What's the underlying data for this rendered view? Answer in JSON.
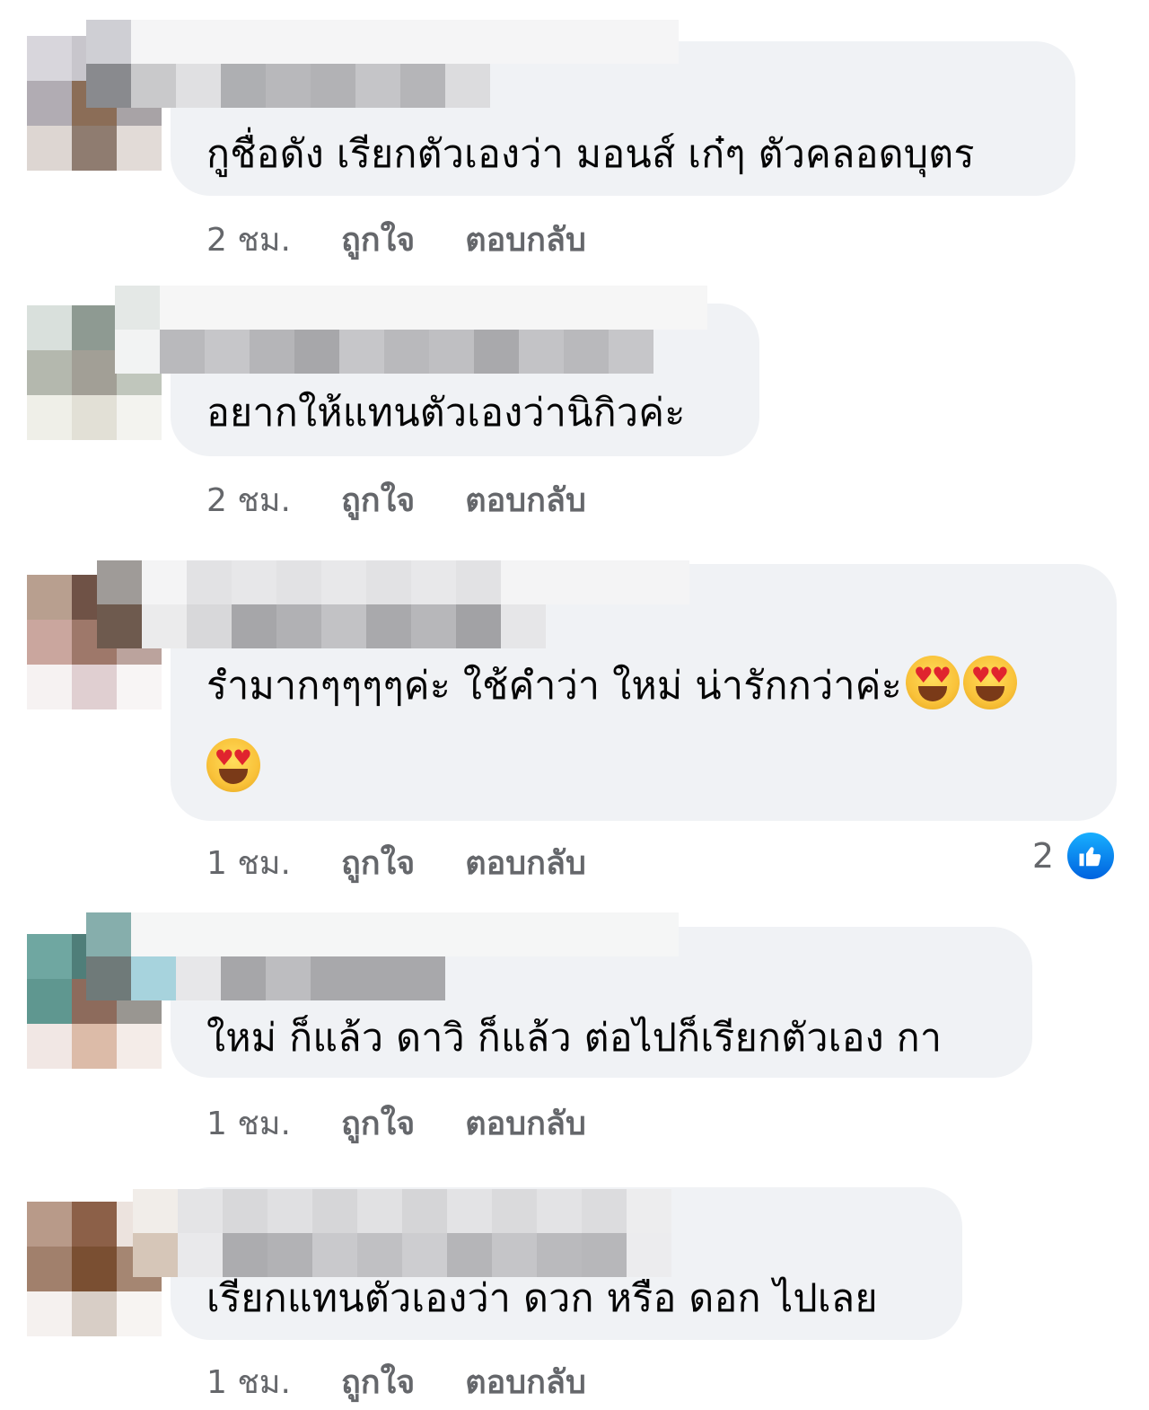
{
  "comments": [
    {
      "text": "กูชื่อดัง เรียกตัวเองว่า มอนส์ เก๋ๆ ตัวคลอดบุตร",
      "time": "2 ชม.",
      "like_label": "ถูกใจ",
      "reply_label": "ตอบกลับ"
    },
    {
      "text": "อยากให้แทนตัวเองว่านิกิวค่ะ",
      "time": "2 ชม.",
      "like_label": "ถูกใจ",
      "reply_label": "ตอบกลับ"
    },
    {
      "text_line1": "รำมากๆๆๆๆค่ะ ใช้คำว่า ใหม่ น่ารักกว่าค่ะ",
      "time": "1 ชม.",
      "like_label": "ถูกใจ",
      "reply_label": "ตอบกลับ",
      "reaction_count": "2",
      "emoji": "heart-eyes-emoji"
    },
    {
      "text": "ใหม่ ก็แล้ว ดาวิ ก็แล้ว ต่อไปก็เรียกตัวเอง กา",
      "time": "1 ชม.",
      "like_label": "ถูกใจ",
      "reply_label": "ตอบกลับ"
    },
    {
      "text": "เรียกแทนตัวเองว่า ดวก หรือ ดอก ไปเลย",
      "time": "1 ชม.",
      "like_label": "ถูกใจ",
      "reply_label": "ตอบกลับ"
    }
  ],
  "colors": {
    "bubble": "#f0f2f5",
    "meta_text": "#65676b",
    "like_blue": "#1877f2"
  }
}
